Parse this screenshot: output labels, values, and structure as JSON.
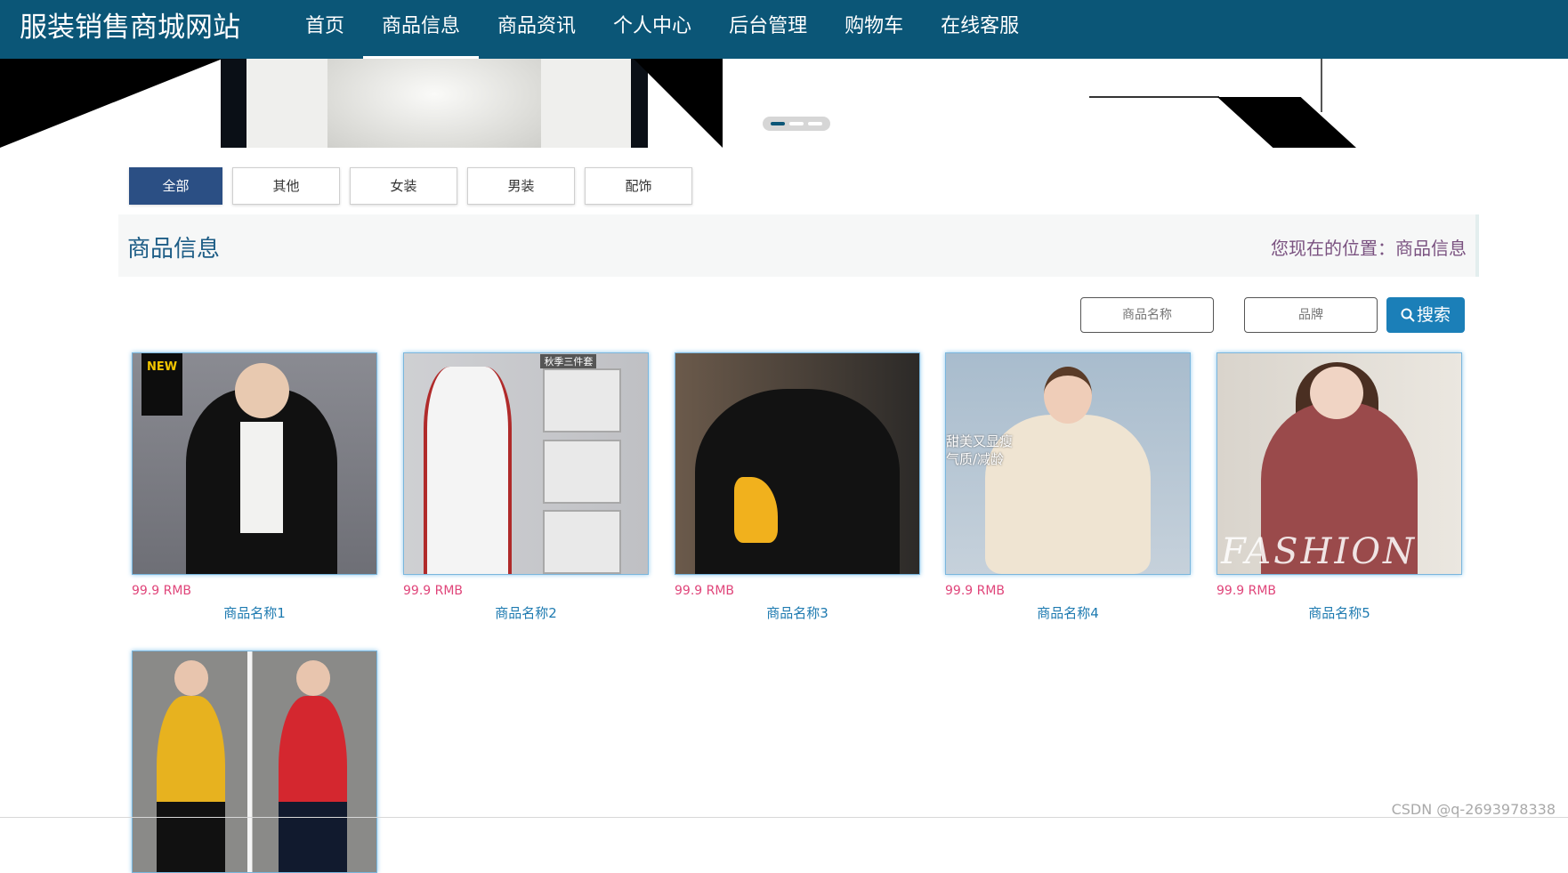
{
  "header": {
    "brand": "服装销售商城网站",
    "nav": [
      {
        "label": "首页",
        "active": false
      },
      {
        "label": "商品信息",
        "active": true
      },
      {
        "label": "商品资讯",
        "active": false
      },
      {
        "label": "个人中心",
        "active": false
      },
      {
        "label": "后台管理",
        "active": false
      },
      {
        "label": "购物车",
        "active": false
      },
      {
        "label": "在线客服",
        "active": false
      }
    ],
    "color": "#0b5677"
  },
  "categories": [
    {
      "label": "全部",
      "active": true
    },
    {
      "label": "其他",
      "active": false
    },
    {
      "label": "女装",
      "active": false
    },
    {
      "label": "男装",
      "active": false
    },
    {
      "label": "配饰",
      "active": false
    }
  ],
  "titlebar": {
    "title": "商品信息",
    "location": "您现在的位置：商品信息"
  },
  "search": {
    "name_placeholder": "商品名称",
    "brand_placeholder": "品牌",
    "button_label": "搜索",
    "button_icon": "search-icon",
    "button_color": "#1b7fb8"
  },
  "products": [
    {
      "price": "99.9 RMB",
      "name": "商品名称1",
      "badge": "NEW"
    },
    {
      "price": "99.9 RMB",
      "name": "商品名称2",
      "label": "秋季三件套"
    },
    {
      "price": "99.9 RMB",
      "name": "商品名称3"
    },
    {
      "price": "99.9 RMB",
      "name": "商品名称4",
      "caption_line1": "甜美又显瘦",
      "caption_line2": "气质/减龄"
    },
    {
      "price": "99.9 RMB",
      "name": "商品名称5",
      "watermark": "FASHION"
    },
    {}
  ],
  "colors": {
    "price": "#e0457a",
    "product_name": "#1d7ab0",
    "active_category": "#2b4f84"
  },
  "watermark": "CSDN @q-2693978338"
}
